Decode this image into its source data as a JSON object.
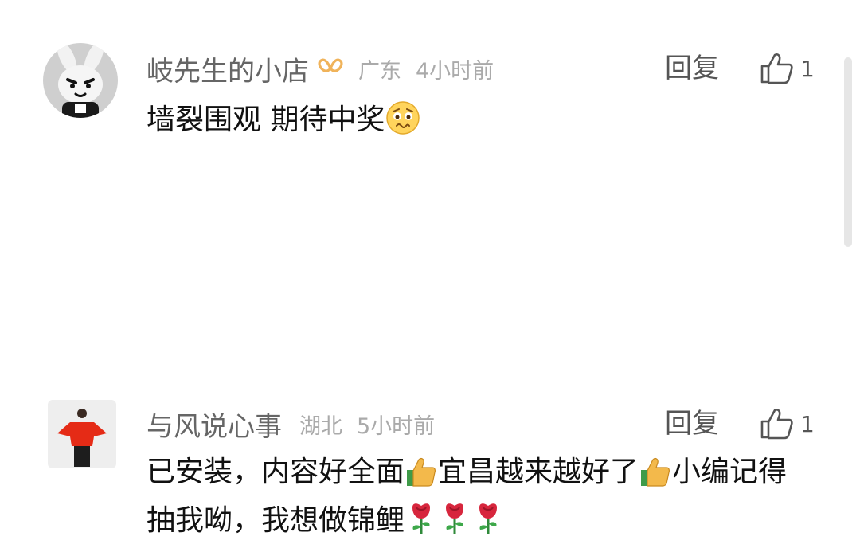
{
  "comments": [
    {
      "username": "岐先生的小店",
      "region": "广东",
      "time": "4小时前",
      "reply_label": "回复",
      "like_count": "1",
      "text": "墙裂围观 期待中奖",
      "avatar_icon": "plush-bunny-avatar",
      "badge_icon": "vip-badge-icon",
      "trailing_emoji": "worried-face-emoji"
    },
    {
      "username": "与风说心事",
      "region": "湖北",
      "time": "5小时前",
      "reply_label": "回复",
      "like_count": "1",
      "segments": [
        "已安装，内容好全面",
        "宜昌越来越好了",
        "小编记得抽我呦，我想做锦鲤"
      ],
      "avatar_icon": "red-coat-person-avatar",
      "emojis": [
        "thumbs-up-emoji",
        "thumbs-up-emoji",
        "rose-emoji",
        "rose-emoji",
        "rose-emoji"
      ]
    }
  ],
  "colors": {
    "username": "#666666",
    "meta": "#aaaaaa",
    "text": "#111111",
    "badge": "#f0b35a",
    "rose": "#d7263d",
    "thumb": "#f3b94b"
  }
}
